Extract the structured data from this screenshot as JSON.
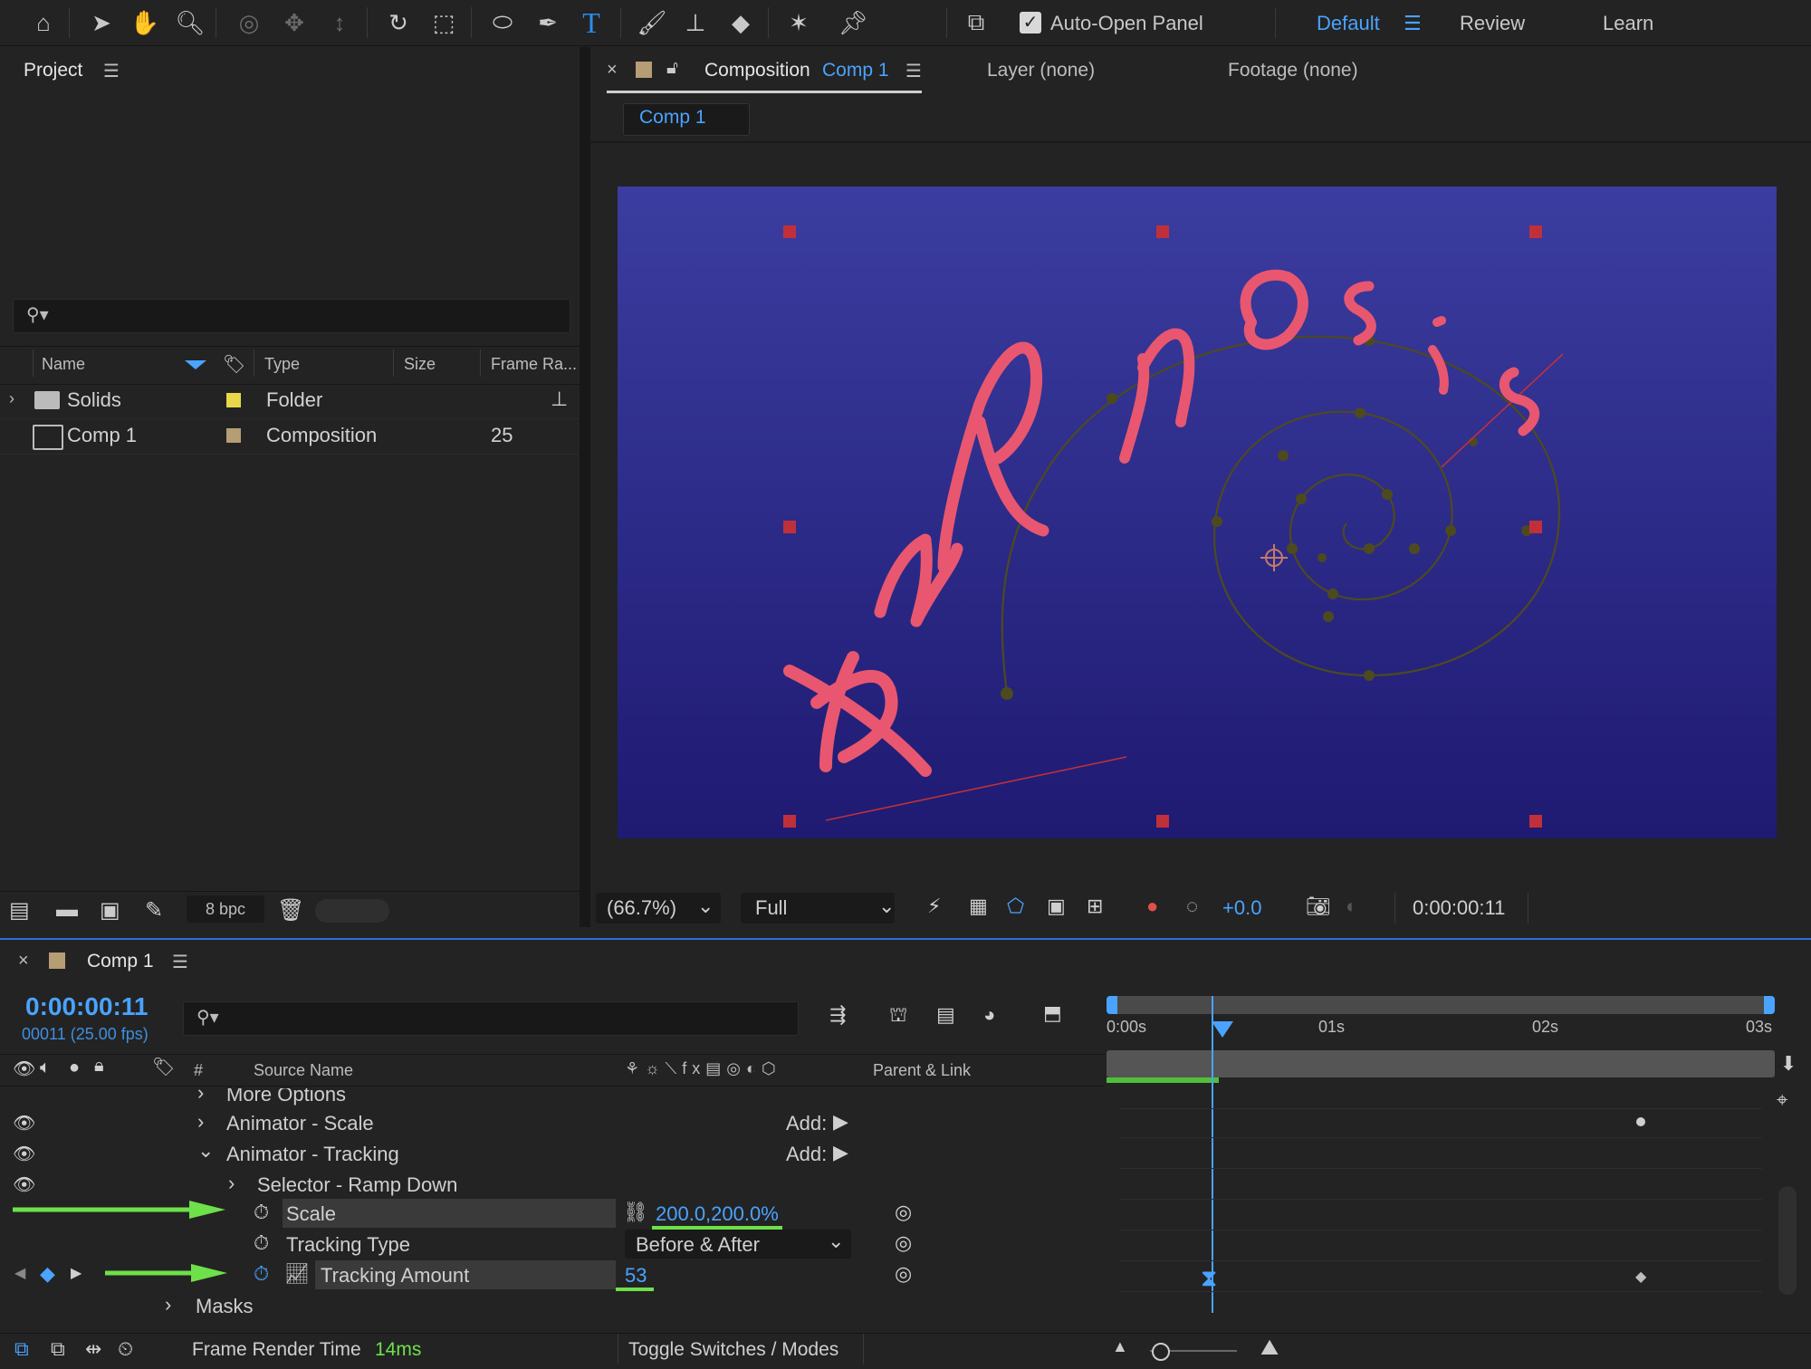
{
  "toolbar": {
    "tools": [
      "home-icon",
      "selection-icon",
      "hand-icon",
      "zoom-icon",
      "orbit-icon",
      "pan-icon",
      "dolly-icon",
      "rotate-icon",
      "anchor-icon",
      "ellipse-icon",
      "pen-icon",
      "type-icon",
      "brush-icon",
      "stamp-icon",
      "eraser-icon",
      "roto-icon",
      "puppet-icon"
    ],
    "auto_open_label": "Auto-Open Panel",
    "workspaces": [
      "Default",
      "Review",
      "Learn"
    ],
    "active_workspace": "Default"
  },
  "project": {
    "title": "Project",
    "search_placeholder": "",
    "columns": [
      "Name",
      "Type",
      "Size",
      "Frame Ra..."
    ],
    "items": [
      {
        "name": "Solids",
        "type": "Folder",
        "size": "",
        "frame_rate": "",
        "label_color": "#e8d84a"
      },
      {
        "name": "Comp 1",
        "type": "Composition",
        "size": "",
        "frame_rate": "25",
        "label_color": "#b59d74"
      }
    ],
    "bpc": "8 bpc"
  },
  "viewer": {
    "tab_prefix": "Composition",
    "tab_comp": "Comp 1",
    "layer_tab": "Layer (none)",
    "footage_tab": "Footage (none)",
    "breadcrumb": "Comp 1",
    "zoom": "(66.7%)",
    "resolution": "Full",
    "exposure": "+0.0",
    "timecode": "0:00:00:11",
    "text_letters": [
      "h",
      "y",
      "p",
      "n",
      "o",
      "s",
      "i",
      "s"
    ],
    "colors": {
      "bg_top": "#3b3da0",
      "bg_bottom": "#1f1a72",
      "text": "#e8576f",
      "path": "#4d4a1e",
      "handle": "#c0303a"
    }
  },
  "timeline": {
    "title": "Comp 1",
    "timecode": "0:00:00:11",
    "frames": "00011 (25.00 fps)",
    "search_placeholder": "",
    "headers": {
      "hash": "#",
      "source_name": "Source Name",
      "parent": "Parent & Link"
    },
    "ruler": [
      "0:00s",
      "01s",
      "02s",
      "03s"
    ],
    "rows": {
      "more_options": "More Options",
      "animator_scale": "Animator - Scale",
      "animator_tracking": "Animator - Tracking",
      "selector": "Selector - Ramp Down",
      "scale": "Scale",
      "scale_value": "200.0,200.0%",
      "tracking_type": "Tracking Type",
      "tracking_type_value": "Before & After",
      "tracking_amount": "Tracking Amount",
      "tracking_amount_value": "53",
      "masks": "Masks",
      "add_label": "Add:"
    },
    "footer": {
      "render_label": "Frame Render Time",
      "render_value": "14ms",
      "toggle": "Toggle Switches / Modes"
    }
  }
}
